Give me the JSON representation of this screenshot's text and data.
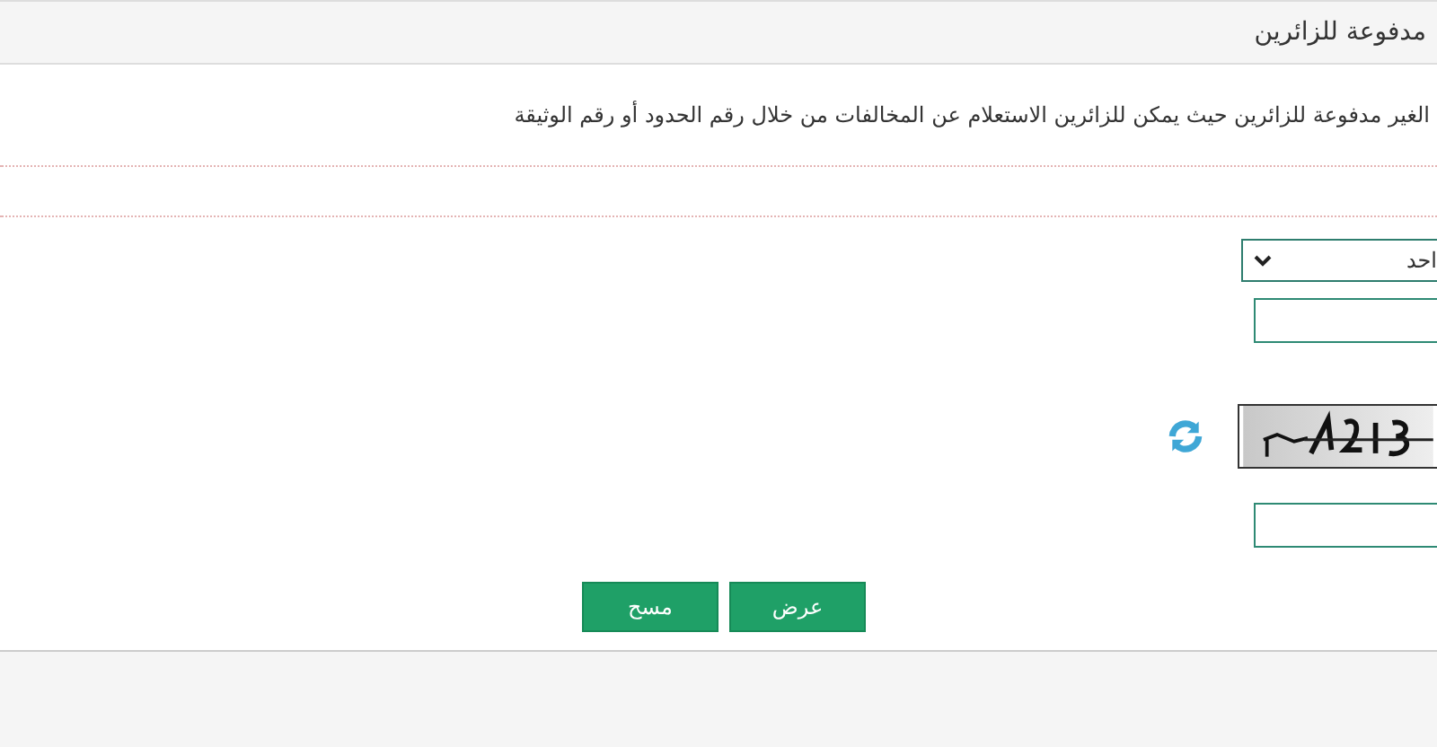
{
  "header": {
    "title": "مدفوعة للزائرين"
  },
  "description": "الغير مدفوعة للزائرين حيث يمكن للزائرين الاستعلام عن المخالفات من خلال رقم الحدود أو رقم الوثيقة",
  "form": {
    "select": {
      "value": "احد"
    },
    "buttons": [
      {
        "label": "عرض"
      },
      {
        "label": "مسح"
      }
    ]
  }
}
